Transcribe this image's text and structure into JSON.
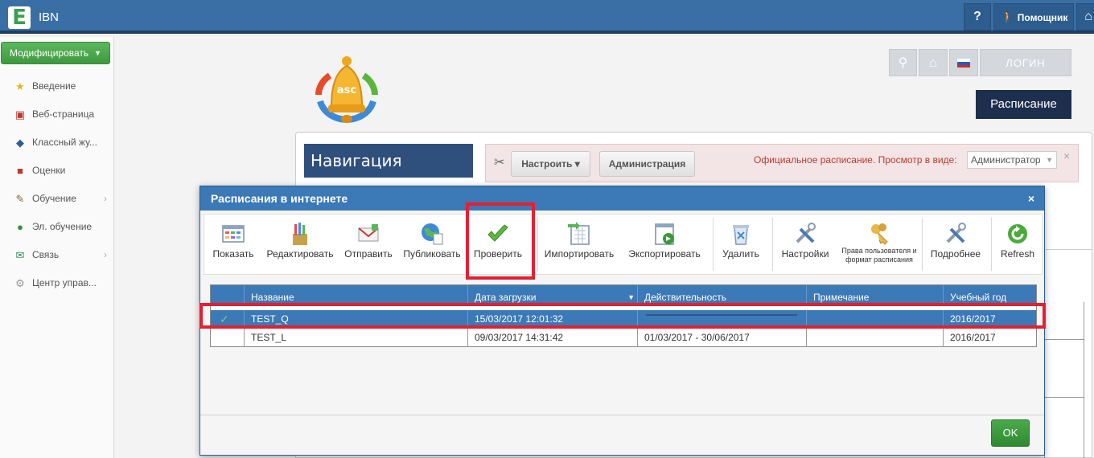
{
  "topbar": {
    "logo_letter": "E",
    "app_title": "IBN",
    "help_label": "?",
    "assistant_label": "Помощник"
  },
  "sidebar": {
    "modify_label": "Модифицировать",
    "items": [
      {
        "label": "Введение",
        "icon": "star-icon"
      },
      {
        "label": "Веб-страница",
        "icon": "web-page-icon"
      },
      {
        "label": "Классный жу...",
        "icon": "journal-icon"
      },
      {
        "label": "Оценки",
        "icon": "grades-icon"
      },
      {
        "label": "Обучение",
        "icon": "education-icon",
        "has_arrow": true
      },
      {
        "label": "Эл. обучение",
        "icon": "elearning-icon"
      },
      {
        "label": "Связь",
        "icon": "communication-icon",
        "has_arrow": true
      },
      {
        "label": "Центр управ...",
        "icon": "control-center-icon"
      }
    ]
  },
  "header": {
    "login_label": "ЛОГИН",
    "schedule_label": "Расписание",
    "bell_text": "asc"
  },
  "navigation": {
    "title": "Навигация"
  },
  "alert": {
    "configure_label": "Настроить ▾",
    "admin_label": "Администрация",
    "message": "Официальное расписание.  Просмотр в виде:",
    "view_as": "Администратор",
    "close": "×"
  },
  "dialog": {
    "title": "Расписания в интернете",
    "close": "×",
    "toolbar": [
      {
        "label": "Показать",
        "icon": "show-icon"
      },
      {
        "label": "Редактировать",
        "icon": "edit-icon"
      },
      {
        "label": "Отправить",
        "icon": "send-icon"
      },
      {
        "label": "Публиковать",
        "icon": "publish-icon"
      },
      {
        "label": "Проверить",
        "icon": "check-icon"
      },
      {
        "label": "Импортировать",
        "icon": "import-icon"
      },
      {
        "label": "Экспортировать",
        "icon": "export-icon"
      },
      {
        "label": "Удалить",
        "icon": "delete-icon"
      },
      {
        "label": "Настройки",
        "icon": "settings-icon"
      },
      {
        "label": "Права пользователя и формат расписания",
        "icon": "rights-icon"
      },
      {
        "label": "Подробнее",
        "icon": "details-icon"
      },
      {
        "label": "Refresh",
        "icon": "refresh-icon"
      }
    ],
    "columns": [
      "",
      "Название",
      "Дата загрузки",
      "Действительность",
      "Примечание",
      "Учебный год"
    ],
    "sort_indicator": "▼",
    "rows": [
      {
        "check": "✓",
        "name": "TEST_Q",
        "upload_date": "15/03/2017 12:01:32",
        "validity": "",
        "note": "",
        "year": "2016/2017",
        "selected": true
      },
      {
        "check": "",
        "name": "TEST_L",
        "upload_date": "09/03/2017 14:31:42",
        "validity": "01/03/2017 - 30/06/2017",
        "note": "",
        "year": "2016/2017",
        "selected": false
      }
    ],
    "ok_label": "OK"
  },
  "colors": {
    "topbar": "#3a6fa6",
    "dialog_header": "#3b79b7",
    "annotation_red": "#e22030",
    "ok_green": "#3f9a3f"
  }
}
